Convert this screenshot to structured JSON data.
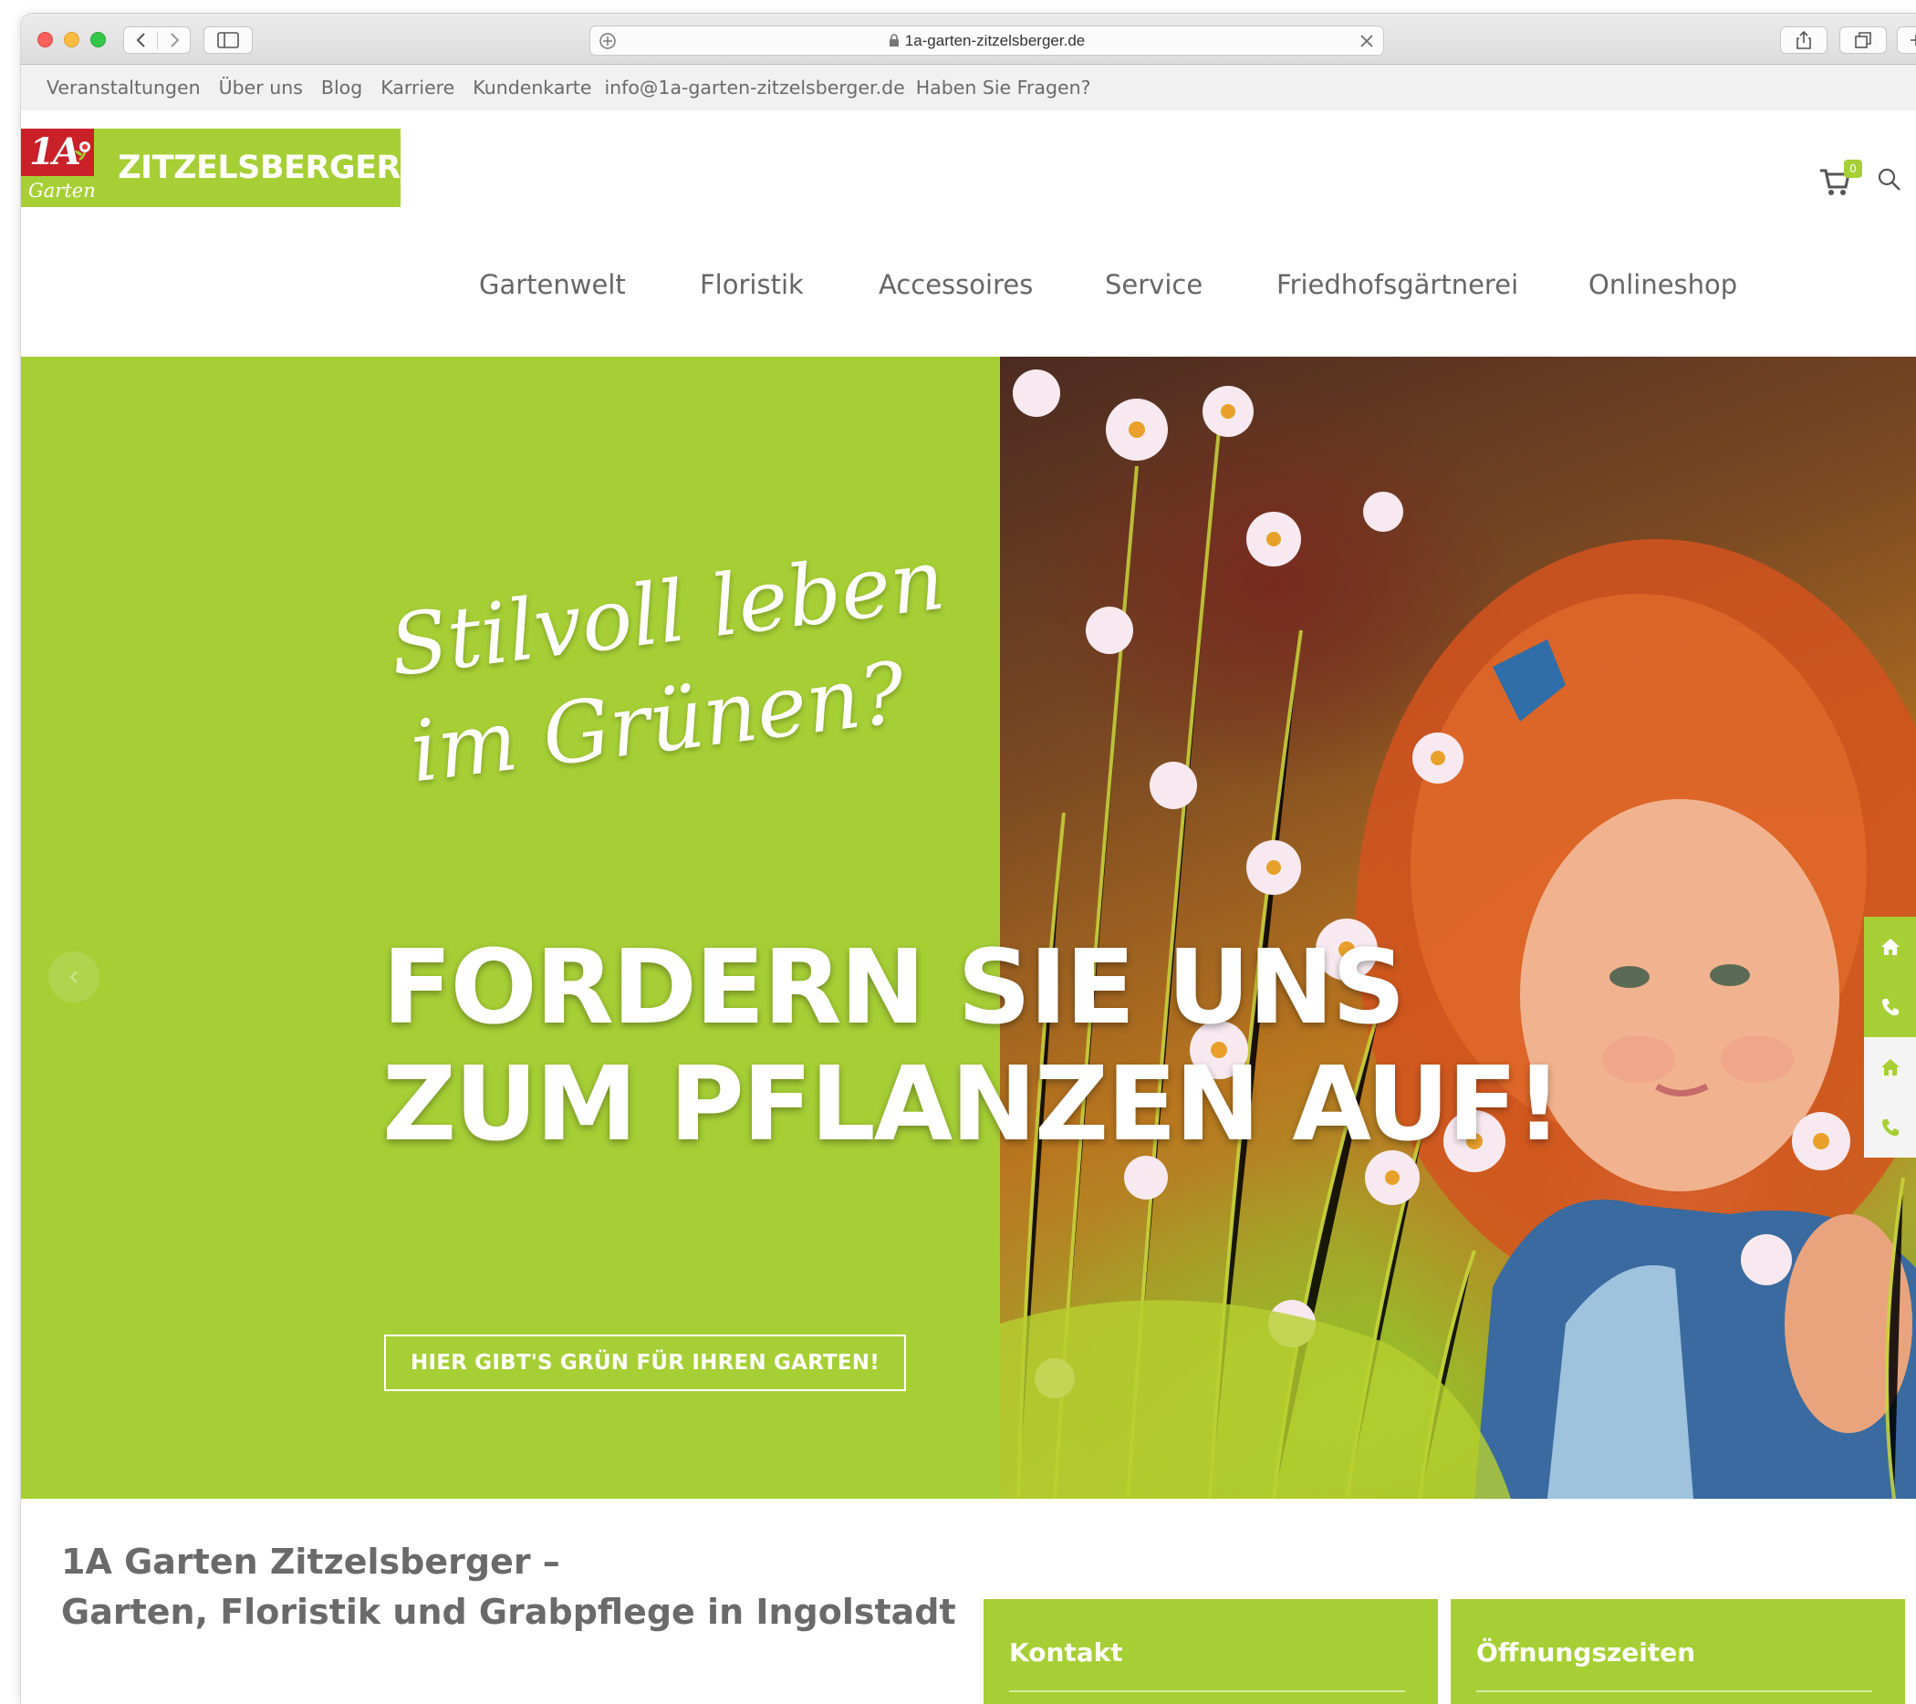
{
  "browser": {
    "url": "1a-garten-zitzelsberger.de"
  },
  "topbar": {
    "links": [
      "Veranstaltungen",
      "Über uns",
      "Blog",
      "Karriere",
      "Kundenkarte",
      "info@1a-garten-zitzelsberger.de",
      "Haben Sie Fragen?"
    ]
  },
  "logo": {
    "mark_top": "1A",
    "mark_bottom": "Garten",
    "name": "ZITZELSBERGER"
  },
  "cart": {
    "count": "0"
  },
  "nav": {
    "items": [
      "Gartenwelt",
      "Floristik",
      "Accessoires",
      "Service",
      "Friedhofsgärtnerei",
      "Onlineshop"
    ],
    "active": "Onlineshop"
  },
  "hero": {
    "script_line1": "Stilvoll leben",
    "script_line2": "im Grünen?",
    "title_line1": "FORDERN SIE UNS",
    "title_line2": "ZUM PFLANZEN AUF!",
    "button": "HIER GIBT'S GRÜN FÜR IHREN GARTEN!"
  },
  "intro": {
    "title_line1": "1A Garten Zitzelsberger –",
    "title_line2": "Garten, Floristik und Grabpflege in Ingolstadt"
  },
  "panels": {
    "kontakt": "Kontakt",
    "oeffnungszeiten": "Öffnungszeiten"
  },
  "colors": {
    "brand_green": "#a6cf35",
    "brand_red": "#c9202a",
    "active_nav": "#b8202d"
  }
}
